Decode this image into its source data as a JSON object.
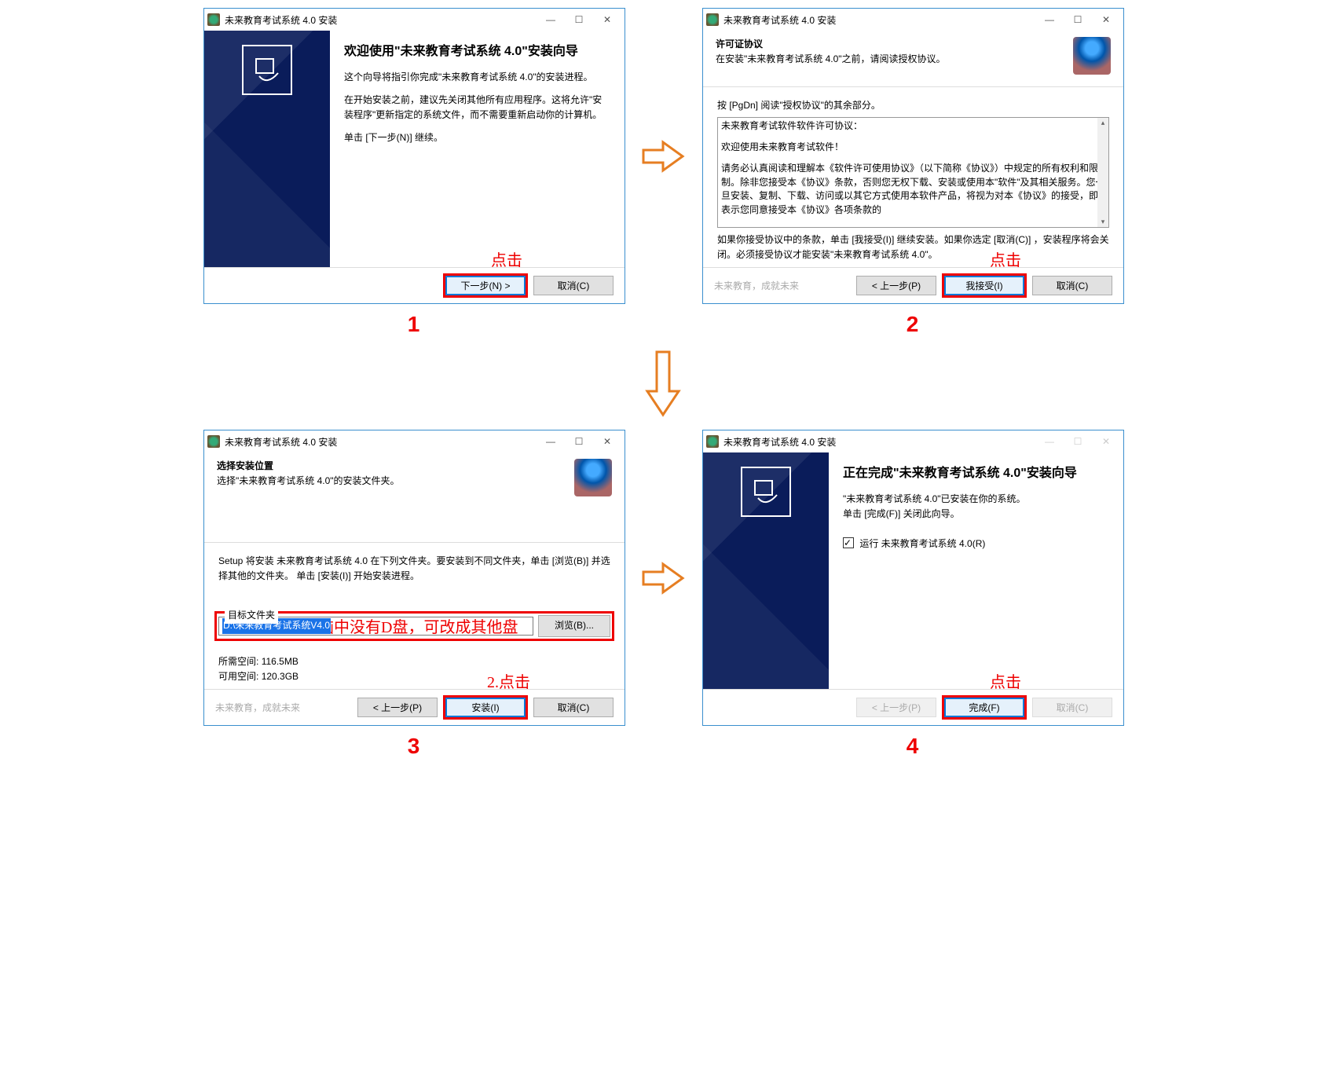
{
  "common": {
    "title": "未来教育考试系统 4.0 安装",
    "slogan": "未来教育，成就未来",
    "btn_next": "下一步(N) >",
    "btn_cancel": "取消(C)",
    "btn_back": "< 上一步(P)",
    "btn_accept": "我接受(I)",
    "btn_install": "安装(I)",
    "btn_browse": "浏览(B)...",
    "btn_finish": "完成(F)",
    "label_click": "点击"
  },
  "step1": {
    "h1": "欢迎使用\"未来教育考试系统 4.0\"安装向导",
    "p1": "这个向导将指引你完成\"未来教育考试系统 4.0\"的安装进程。",
    "p2": "在开始安装之前，建议先关闭其他所有应用程序。这将允许\"安装程序\"更新指定的系统文件，而不需要重新启动你的计算机。",
    "p3": "单击 [下一步(N)] 继续。",
    "num": "1"
  },
  "step2": {
    "h_title": "许可证协议",
    "h_sub": "在安装\"未来教育考试系统 4.0\"之前，请阅读授权协议。",
    "pre": "按 [PgDn] 阅读\"授权协议\"的其余部分。",
    "lic1": "未来教育考试软件软件许可协议：",
    "lic2": "欢迎使用未来教育考试软件！",
    "lic3": "请务必认真阅读和理解本《软件许可使用协议》（以下简称《协议》）中规定的所有权利和限制。除非您接受本《协议》条款，否则您无权下载、安装或使用本\"软件\"及其相关服务。您一旦安装、复制、下载、访问或以其它方式使用本软件产品，将视为对本《协议》的接受，即表示您同意接受本《协议》各项条款的",
    "post": "如果你接受协议中的条款，单击 [我接受(I)] 继续安装。如果你选定 [取消(C)] ，安装程序将会关闭。必须接受协议才能安装\"未来教育考试系统 4.0\"。",
    "num": "2"
  },
  "step3": {
    "h_title": "选择安装位置",
    "h_sub": "选择\"未来教育考试系统 4.0\"的安装文件夹。",
    "instr": "Setup 将安装 未来教育考试系统 4.0 在下列文件夹。要安装到不同文件夹，单击 [浏览(B)] 并选择其他的文件夹。 单击 [安装(I)] 开始安装进程。",
    "group": "目标文件夹",
    "path": "D:\\未来教育考试系统V4.0",
    "req_label": "所需空间:",
    "req_val": "116.5MB",
    "avail_label": "可用空间:",
    "avail_val": "120.3GB",
    "anno1": "1.若电脑中没有D盘，可改成其他盘",
    "anno2": "2.点击",
    "num": "3"
  },
  "step4": {
    "h1": "正在完成\"未来教育考试系统 4.0\"安装向导",
    "p1": "\"未来教育考试系统 4.0\"已安装在你的系统。\n单击 [完成(F)] 关闭此向导。",
    "chk": "运行 未来教育考试系统 4.0(R)",
    "num": "4"
  }
}
